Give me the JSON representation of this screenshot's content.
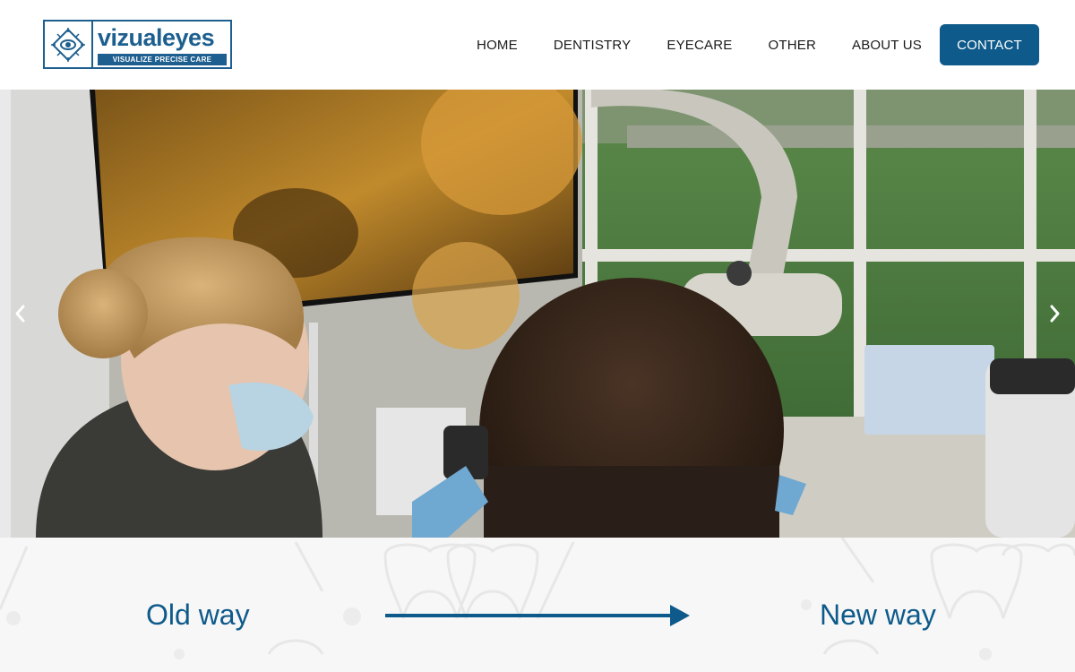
{
  "brand": {
    "name": "vizualeyes",
    "tagline": "VISUALIZE PRECISE CARE",
    "color": "#1d5f8f"
  },
  "nav": {
    "items": [
      {
        "label": "HOME"
      },
      {
        "label": "DENTISTRY"
      },
      {
        "label": "EYECARE"
      },
      {
        "label": "OTHER"
      },
      {
        "label": "ABOUT US"
      }
    ],
    "contact_label": "CONTACT",
    "accent": "#0e5a8a"
  },
  "hero": {
    "image_semantic": "dental-clinic-photo",
    "prev_icon": "chevron-left-icon",
    "next_icon": "chevron-right-icon"
  },
  "comparison": {
    "left_label": "Old way",
    "right_label": "New way",
    "arrow_icon": "arrow-right-icon"
  }
}
